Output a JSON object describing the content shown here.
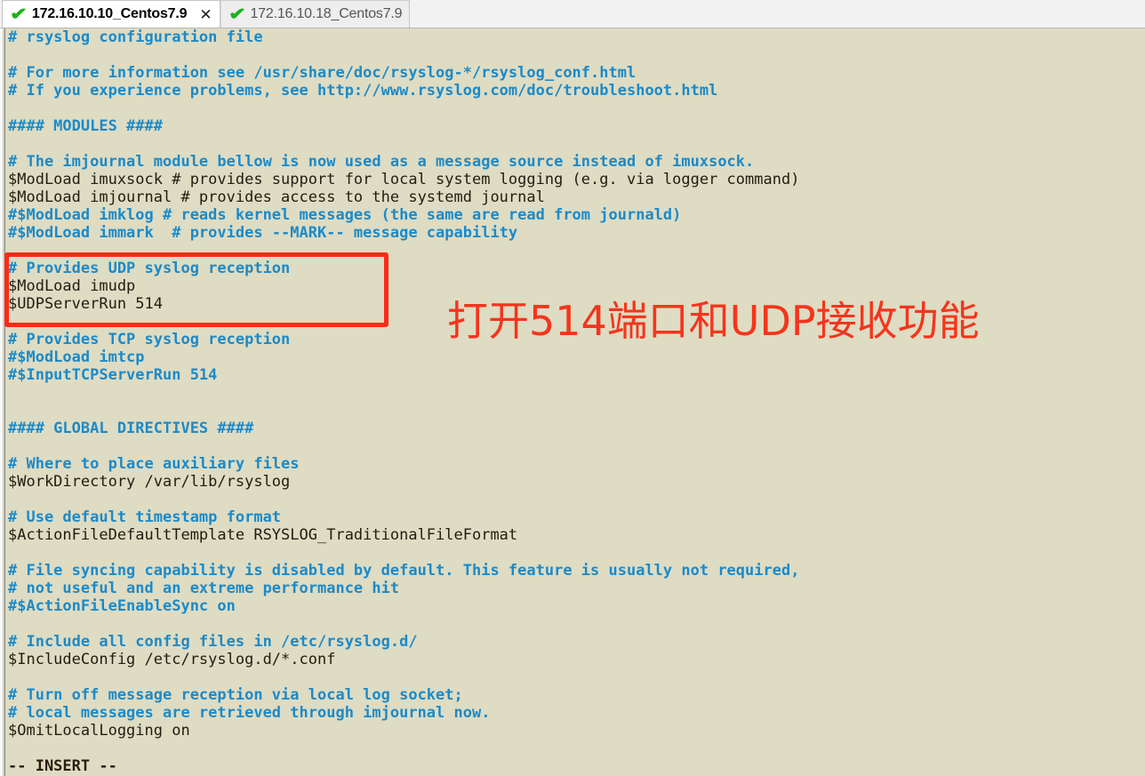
{
  "window": {
    "background_color": "#dedcc3",
    "comment_color": "#1b8ac9",
    "code_color": "#231c10",
    "annotation_color": "#f4351c"
  },
  "tab_bar": {
    "tabs": [
      {
        "label": "172.16.10.10_Centos7.9",
        "status_icon": "check-icon",
        "active": true,
        "close_label": "✕"
      },
      {
        "label": "172.16.10.18_Centos7.9",
        "status_icon": "check-icon",
        "active": false
      }
    ]
  },
  "editor": {
    "status_line": "-- INSERT --",
    "lines": [
      {
        "type": "comment",
        "text": "# rsyslog configuration file"
      },
      {
        "type": "blank",
        "text": ""
      },
      {
        "type": "comment",
        "text": "# For more information see /usr/share/doc/rsyslog-*/rsyslog_conf.html"
      },
      {
        "type": "comment",
        "text": "# If you experience problems, see http://www.rsyslog.com/doc/troubleshoot.html"
      },
      {
        "type": "blank",
        "text": ""
      },
      {
        "type": "comment",
        "text": "#### MODULES ####"
      },
      {
        "type": "blank",
        "text": ""
      },
      {
        "type": "comment",
        "text": "# The imjournal module bellow is now used as a message source instead of imuxsock."
      },
      {
        "type": "code",
        "text": "$ModLoad imuxsock # provides support for local system logging (e.g. via logger command)"
      },
      {
        "type": "code",
        "text": "$ModLoad imjournal # provides access to the systemd journal"
      },
      {
        "type": "comment",
        "text": "#$ModLoad imklog # reads kernel messages (the same are read from journald)"
      },
      {
        "type": "comment",
        "text": "#$ModLoad immark  # provides --MARK-- message capability"
      },
      {
        "type": "blank",
        "text": ""
      },
      {
        "type": "comment",
        "text": "# Provides UDP syslog reception"
      },
      {
        "type": "code",
        "text": "$ModLoad imudp"
      },
      {
        "type": "code",
        "text": "$UDPServerRun 514"
      },
      {
        "type": "blank",
        "text": ""
      },
      {
        "type": "comment",
        "text": "# Provides TCP syslog reception"
      },
      {
        "type": "comment",
        "text": "#$ModLoad imtcp"
      },
      {
        "type": "comment",
        "text": "#$InputTCPServerRun 514"
      },
      {
        "type": "blank",
        "text": ""
      },
      {
        "type": "blank",
        "text": ""
      },
      {
        "type": "comment",
        "text": "#### GLOBAL DIRECTIVES ####"
      },
      {
        "type": "blank",
        "text": ""
      },
      {
        "type": "comment",
        "text": "# Where to place auxiliary files"
      },
      {
        "type": "code",
        "text": "$WorkDirectory /var/lib/rsyslog"
      },
      {
        "type": "blank",
        "text": ""
      },
      {
        "type": "comment",
        "text": "# Use default timestamp format"
      },
      {
        "type": "code",
        "text": "$ActionFileDefaultTemplate RSYSLOG_TraditionalFileFormat"
      },
      {
        "type": "blank",
        "text": ""
      },
      {
        "type": "comment",
        "text": "# File syncing capability is disabled by default. This feature is usually not required,"
      },
      {
        "type": "comment",
        "text": "# not useful and an extreme performance hit"
      },
      {
        "type": "comment",
        "text": "#$ActionFileEnableSync on"
      },
      {
        "type": "blank",
        "text": ""
      },
      {
        "type": "comment",
        "text": "# Include all config files in /etc/rsyslog.d/"
      },
      {
        "type": "code",
        "text": "$IncludeConfig /etc/rsyslog.d/*.conf"
      },
      {
        "type": "blank",
        "text": ""
      },
      {
        "type": "comment",
        "text": "# Turn off message reception via local log socket;"
      },
      {
        "type": "comment",
        "text": "# local messages are retrieved through imjournal now."
      },
      {
        "type": "code",
        "text": "$OmitLocalLogging on"
      },
      {
        "type": "blank",
        "text": ""
      },
      {
        "type": "insert",
        "text": "-- INSERT --"
      }
    ]
  },
  "annotations": {
    "chinese_note": "打开514端口和UDP接收功能",
    "highlight_box": {
      "shape": "rectangle",
      "color": "#fc2a15"
    }
  }
}
